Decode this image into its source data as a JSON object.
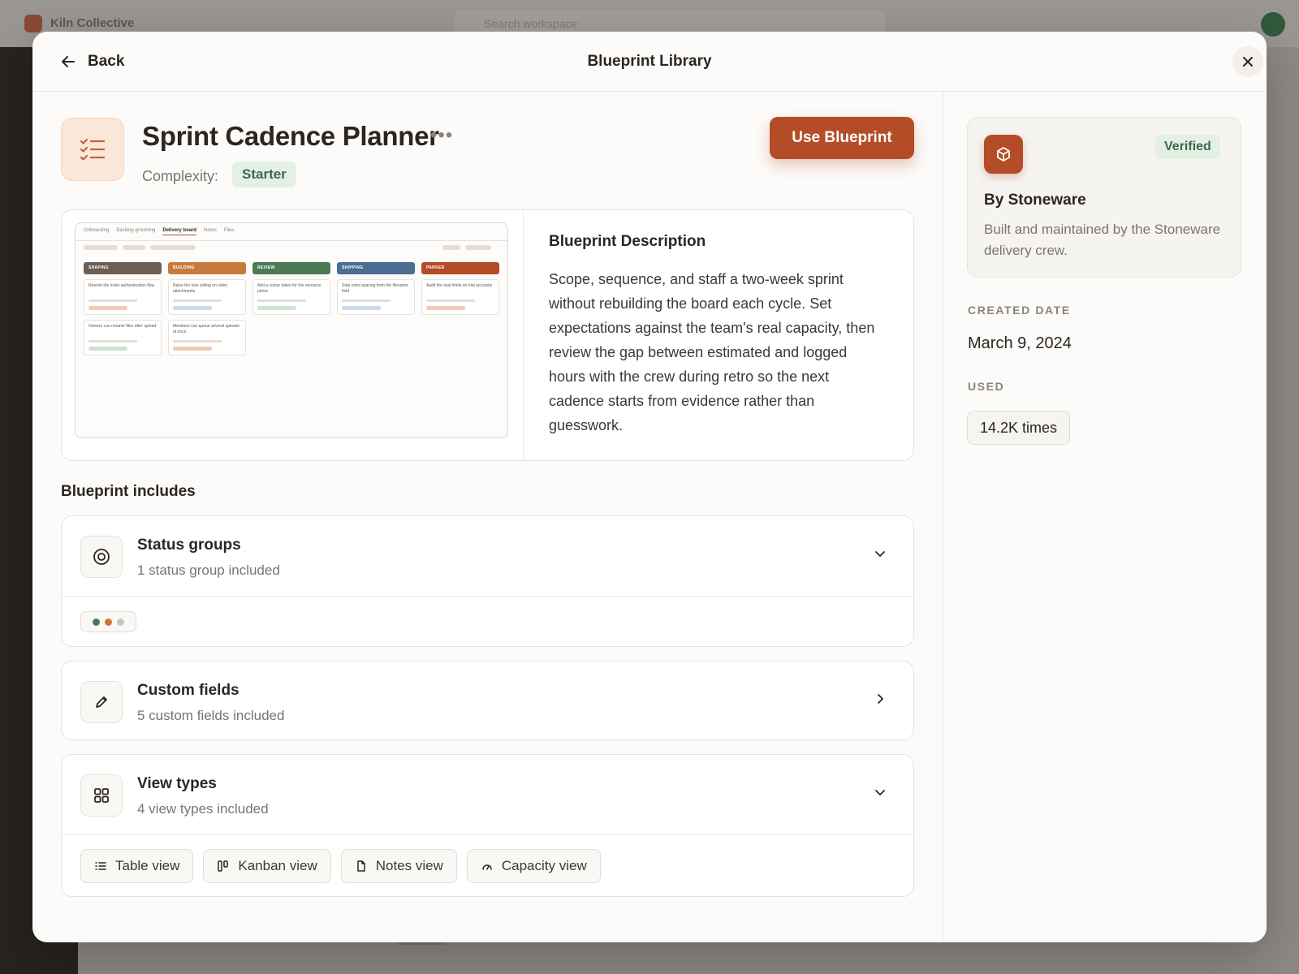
{
  "background": {
    "workspace_name": "Kiln Collective",
    "search_placeholder": "Search workspace"
  },
  "modal": {
    "back_label": "Back",
    "title": "Blueprint Library"
  },
  "blueprint": {
    "name": "Sprint Cadence Planner",
    "complexity_label": "Complexity:",
    "complexity_value": "Starter",
    "use_button": "Use Blueprint",
    "description_heading": "Blueprint Description",
    "description": "Scope, sequence, and staff a two-week sprint without rebuilding the board each cycle. Set expectations against the team's real capacity, then review the gap between estimated and logged hours with the crew during retro so the next cadence starts from evidence rather than guesswork."
  },
  "preview": {
    "tabs": [
      "Onboarding",
      "Backlog grooming",
      "Delivery board",
      "Notes",
      "Files"
    ],
    "active_tab": "Delivery board",
    "columns": [
      {
        "name": "SHAPING",
        "color": "#6b5e55",
        "accent": "#f0c9b3",
        "cards": [
          "Rework the invite authentication flow",
          "Owners can rename files after upload"
        ],
        "card_accents": [
          "#f0c9b3",
          "#cfe3d5"
        ]
      },
      {
        "name": "BUILDING",
        "color": "#c87a3d",
        "accent": "#cdd9ee",
        "cards": [
          "Raise the size ceiling on video attachments",
          "Members can queue several uploads at once"
        ],
        "card_accents": [
          "#cdd9ee",
          "#f0c9b3"
        ]
      },
      {
        "name": "REVIEW",
        "color": "#4c7a55",
        "accent": "#cfe3d5",
        "cards": [
          "Add a colour token for the resource picker"
        ],
        "card_accents": [
          "#cfe3d5"
        ]
      },
      {
        "name": "SHIPPING",
        "color": "#4a6d92",
        "accent": "#cdd9ee",
        "cards": [
          "Strip extra spacing from the filename field"
        ],
        "card_accents": [
          "#cdd9ee"
        ]
      },
      {
        "name": "PARKED",
        "color": "#b44c27",
        "accent": "#f0c9b3",
        "cards": [
          "Audit the seat limits on trial accounts"
        ],
        "card_accents": [
          "#f0c9b3"
        ]
      }
    ]
  },
  "includes": {
    "heading": "Blueprint includes",
    "status_groups": {
      "title": "Status groups",
      "subtitle": "1 status group included",
      "dot_colors": [
        "#4c7a55",
        "#c87a3d",
        "#c9c4bd"
      ]
    },
    "custom_fields": {
      "title": "Custom fields",
      "subtitle": "5 custom fields included"
    },
    "view_types": {
      "title": "View types",
      "subtitle": "4 view types included",
      "views": [
        {
          "label": "Table view",
          "icon": "list-icon"
        },
        {
          "label": "Kanban view",
          "icon": "kanban-icon"
        },
        {
          "label": "Notes view",
          "icon": "document-icon"
        },
        {
          "label": "Capacity view",
          "icon": "gauge-icon"
        }
      ]
    }
  },
  "author": {
    "name": "By Stoneware",
    "badge": "Verified",
    "description": "Built and maintained by the Stoneware delivery crew."
  },
  "meta": {
    "created_label": "CREATED DATE",
    "created_value": "March 9, 2024",
    "used_label": "USED",
    "used_value": "14.2K times"
  },
  "colors": {
    "accent": "#b44c27",
    "success_bg": "#e4efe6",
    "success_text": "#3a6a48"
  }
}
